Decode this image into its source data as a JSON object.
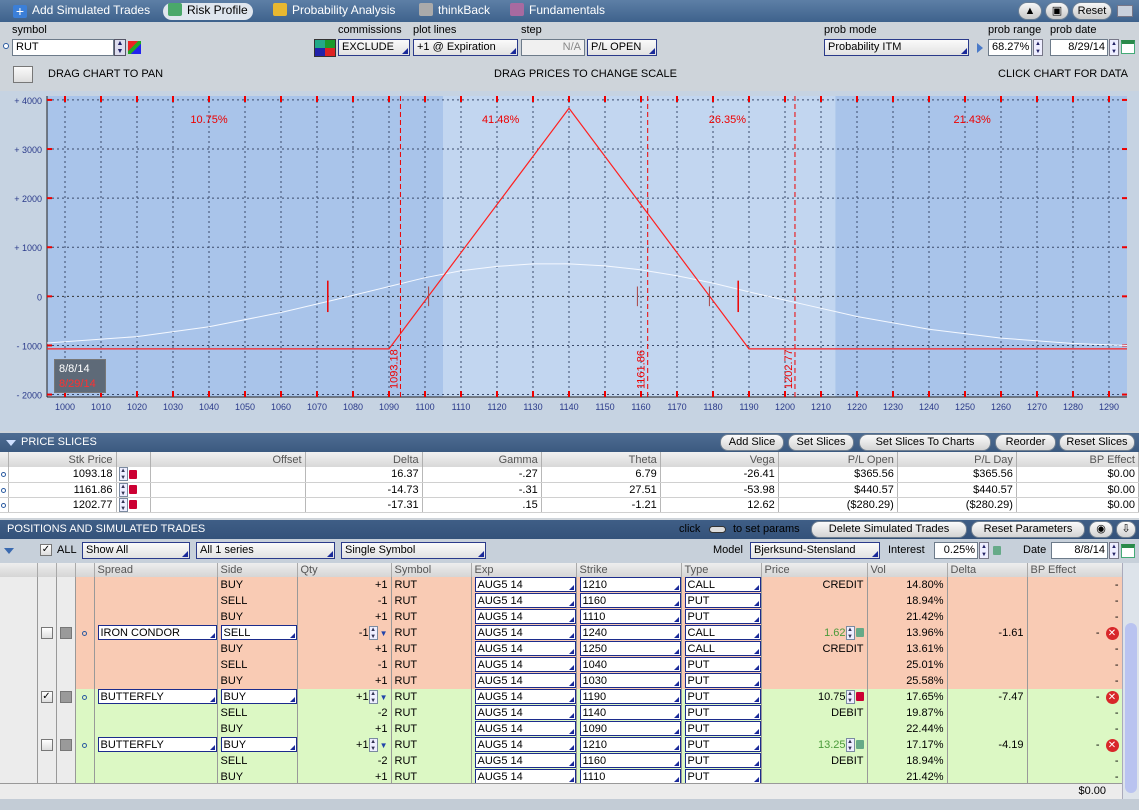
{
  "toolbar": {
    "tabs": [
      {
        "label": "Add Simulated Trades",
        "icon": "plus-icon"
      },
      {
        "label": "Risk Profile",
        "icon": "risk-profile-icon"
      },
      {
        "label": "Probability Analysis",
        "icon": "probability-icon"
      },
      {
        "label": "thinkBack",
        "icon": "thinkback-icon"
      },
      {
        "label": "Fundamentals",
        "icon": "fundamentals-icon"
      }
    ],
    "reset_label": "Reset"
  },
  "controls": {
    "symbol_label": "symbol",
    "symbol_value": "RUT",
    "commissions_label": "commissions",
    "commissions_value": "EXCLUDE",
    "plot_lines_label": "plot lines",
    "plot_lines_value": "+1 @ Expiration",
    "step_label": "step",
    "step_value": "N/A",
    "pl_mode": "P/L OPEN",
    "prob_mode_label": "prob mode",
    "prob_mode_value": "Probability ITM",
    "prob_range_label": "prob range",
    "prob_range_value": "68.27%",
    "prob_date_label": "prob date",
    "prob_date_value": "8/29/14"
  },
  "chart_header": {
    "left": "DRAG CHART TO PAN",
    "center": "DRAG PRICES TO CHANGE SCALE",
    "right": "CLICK CHART FOR DATA"
  },
  "chart_data": {
    "type": "line",
    "xlim": [
      995,
      1295
    ],
    "ylim": [
      -2050,
      4080
    ],
    "x_ticks": [
      1000,
      1010,
      1020,
      1030,
      1040,
      1050,
      1060,
      1070,
      1080,
      1090,
      1100,
      1110,
      1120,
      1130,
      1140,
      1150,
      1160,
      1170,
      1180,
      1190,
      1200,
      1210,
      1220,
      1230,
      1240,
      1250,
      1260,
      1270,
      1280,
      1290
    ],
    "y_ticks": [
      {
        "v": 4000,
        "label": "+ 4000"
      },
      {
        "v": 3000,
        "label": "+ 3000"
      },
      {
        "v": 2000,
        "label": "+ 2000"
      },
      {
        "v": 1000,
        "label": "+ 1000"
      },
      {
        "v": 0,
        "label": "0"
      },
      {
        "v": -1000,
        "label": "- 1000"
      },
      {
        "v": -2000,
        "label": "- 2000"
      }
    ],
    "series": [
      {
        "x": [
          995,
          1090,
          1140,
          1190,
          1295
        ],
        "y": [
          -1070,
          -1070,
          3830,
          -1070,
          -1070
        ],
        "color": "#ff2020"
      }
    ],
    "prob_curve": {
      "x": [
        995,
        1020,
        1040,
        1060,
        1075,
        1090,
        1100,
        1110,
        1120,
        1130,
        1140,
        1150,
        1160,
        1170,
        1180,
        1190,
        1205,
        1220,
        1240,
        1260,
        1280,
        1295
      ],
      "y": [
        -950,
        -820,
        -620,
        -330,
        -70,
        200,
        380,
        520,
        610,
        660,
        660,
        620,
        540,
        420,
        270,
        90,
        -160,
        -410,
        -670,
        -850,
        -960,
        -1000
      ]
    },
    "shaded_band": [
      1105,
      1214
    ],
    "slice_lines": [
      {
        "x": 1093.18,
        "label": "1093.18"
      },
      {
        "x": 1161.86,
        "label": "1161.86"
      },
      {
        "x": 1202.77,
        "label": "1202.77"
      }
    ],
    "range_markers": [
      1073,
      1187
    ],
    "center_markers": [
      1101,
      1159,
      1179
    ],
    "probabilities": [
      {
        "x": 1040,
        "label": "10.75%"
      },
      {
        "x": 1121,
        "label": "41.48%"
      },
      {
        "x": 1184,
        "label": "26.35%"
      },
      {
        "x": 1252,
        "label": "21.43%"
      }
    ],
    "legend_dates": [
      "8/8/14",
      "8/29/14"
    ]
  },
  "price_slices": {
    "title": "PRICE SLICES",
    "buttons": [
      "Add Slice",
      "Set Slices",
      "Set Slices To Charts",
      "Reorder",
      "Reset Slices"
    ],
    "columns": [
      "Stk Price",
      "Offset",
      "Delta",
      "Gamma",
      "Theta",
      "Vega",
      "P/L Open",
      "P/L Day",
      "BP Effect"
    ],
    "rows": [
      [
        "1093.18",
        "",
        "16.37",
        "-.27",
        "6.79",
        "-26.41",
        "$365.56",
        "$365.56",
        "$0.00"
      ],
      [
        "1161.86",
        "",
        "-14.73",
        "-.31",
        "27.51",
        "-53.98",
        "$440.57",
        "$440.57",
        "$0.00"
      ],
      [
        "1202.77",
        "",
        "-17.31",
        ".15",
        "-1.21",
        "12.62",
        "($280.29)",
        "($280.29)",
        "$0.00"
      ]
    ]
  },
  "positions": {
    "title": "POSITIONS AND SIMULATED TRADES",
    "hint_pre": "click",
    "hint_post": "to set params",
    "delete_label": "Delete Simulated Trades",
    "reset_params_label": "Reset Parameters",
    "all_label": "ALL",
    "show_filter": "Show All",
    "series_filter": "All 1 series",
    "symbol_filter": "Single Symbol",
    "model_label": "Model",
    "model_value": "Bjerksund-Stensland",
    "interest_label": "Interest",
    "interest_value": "0.25%",
    "date_label": "Date",
    "date_value": "8/8/14",
    "columns": [
      "Spread",
      "Side",
      "Qty",
      "Symbol",
      "Exp",
      "Strike",
      "Type",
      "Price",
      "Vol",
      "Delta",
      "BP Effect"
    ],
    "rows": [
      {
        "c": "R",
        "first": false,
        "spread": "",
        "side": "BUY",
        "qty": "+1",
        "sym": "RUT",
        "exp": "AUG5 14",
        "strike": "1210",
        "type": "CALL",
        "price": "CREDIT",
        "vol": "14.80%",
        "delta": "",
        "bp": "-"
      },
      {
        "c": "R",
        "first": false,
        "spread": "",
        "side": "SELL",
        "qty": "-1",
        "sym": "RUT",
        "exp": "AUG5 14",
        "strike": "1160",
        "type": "PUT",
        "price": "",
        "vol": "18.94%",
        "delta": "",
        "bp": "-"
      },
      {
        "c": "R",
        "first": false,
        "spread": "",
        "side": "BUY",
        "qty": "+1",
        "sym": "RUT",
        "exp": "AUG5 14",
        "strike": "1110",
        "type": "PUT",
        "price": "",
        "vol": "21.42%",
        "delta": "",
        "bp": "-"
      },
      {
        "c": "R",
        "first": true,
        "checked": false,
        "spread": "IRON CONDOR",
        "side": "SELL",
        "qty": "-1",
        "sym": "RUT",
        "exp": "AUG5 14",
        "strike": "1240",
        "type": "CALL",
        "price": "1.62",
        "vol": "13.96%",
        "delta": "-1.61",
        "bp": "-"
      },
      {
        "c": "R",
        "first": false,
        "spread": "",
        "side": "BUY",
        "qty": "+1",
        "sym": "RUT",
        "exp": "AUG5 14",
        "strike": "1250",
        "type": "CALL",
        "price": "CREDIT",
        "vol": "13.61%",
        "delta": "",
        "bp": "-"
      },
      {
        "c": "R",
        "first": false,
        "spread": "",
        "side": "SELL",
        "qty": "-1",
        "sym": "RUT",
        "exp": "AUG5 14",
        "strike": "1040",
        "type": "PUT",
        "price": "",
        "vol": "25.01%",
        "delta": "",
        "bp": "-"
      },
      {
        "c": "R",
        "first": false,
        "spread": "",
        "side": "BUY",
        "qty": "+1",
        "sym": "RUT",
        "exp": "AUG5 14",
        "strike": "1030",
        "type": "PUT",
        "price": "",
        "vol": "25.58%",
        "delta": "",
        "bp": "-"
      },
      {
        "c": "G",
        "first": true,
        "checked": true,
        "spread": "BUTTERFLY",
        "side": "BUY",
        "qty": "+1",
        "sym": "RUT",
        "exp": "AUG5 14",
        "strike": "1190",
        "type": "PUT",
        "price": "10.75",
        "vol": "17.65%",
        "delta": "-7.47",
        "bp": "-"
      },
      {
        "c": "G",
        "first": false,
        "spread": "",
        "side": "SELL",
        "qty": "-2",
        "sym": "RUT",
        "exp": "AUG5 14",
        "strike": "1140",
        "type": "PUT",
        "price": "DEBIT",
        "vol": "19.87%",
        "delta": "",
        "bp": "-"
      },
      {
        "c": "G",
        "first": false,
        "spread": "",
        "side": "BUY",
        "qty": "+1",
        "sym": "RUT",
        "exp": "AUG5 14",
        "strike": "1090",
        "type": "PUT",
        "price": "",
        "vol": "22.44%",
        "delta": "",
        "bp": "-"
      },
      {
        "c": "G",
        "first": true,
        "checked": false,
        "spread": "BUTTERFLY",
        "side": "BUY",
        "qty": "+1",
        "sym": "RUT",
        "exp": "AUG5 14",
        "strike": "1210",
        "type": "PUT",
        "price": "13.25",
        "vol": "17.17%",
        "delta": "-4.19",
        "bp": "-"
      },
      {
        "c": "G",
        "first": false,
        "spread": "",
        "side": "SELL",
        "qty": "-2",
        "sym": "RUT",
        "exp": "AUG5 14",
        "strike": "1160",
        "type": "PUT",
        "price": "DEBIT",
        "vol": "18.94%",
        "delta": "",
        "bp": "-"
      },
      {
        "c": "G",
        "first": false,
        "spread": "",
        "side": "BUY",
        "qty": "+1",
        "sym": "RUT",
        "exp": "AUG5 14",
        "strike": "1110",
        "type": "PUT",
        "price": "",
        "vol": "21.42%",
        "delta": "",
        "bp": "-"
      }
    ],
    "total_bp": "$0.00"
  }
}
